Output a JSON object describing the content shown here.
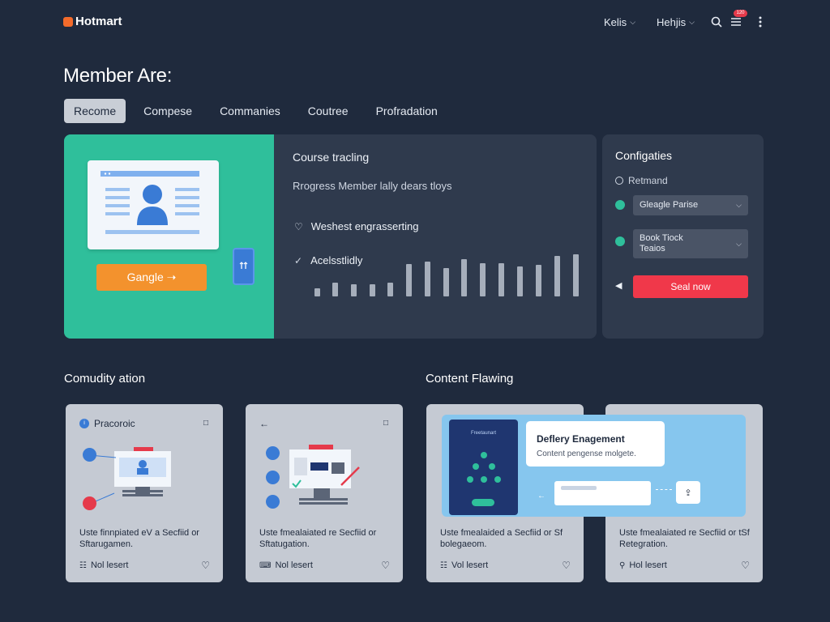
{
  "app": {
    "brand": "Hotmart"
  },
  "topbar": {
    "menu1": "Kelis",
    "menu2": "Hehjis",
    "notification_count": "120"
  },
  "page": {
    "title": "Member Are:"
  },
  "tabs": [
    {
      "label": "Recome",
      "active": true
    },
    {
      "label": "Compese"
    },
    {
      "label": "Commanies"
    },
    {
      "label": "Coutree"
    },
    {
      "label": "Profradation"
    }
  ],
  "hero": {
    "cta": "Gangle ➝",
    "heading": "Course tracling",
    "sub": "Rrogress Member lally dears tloys",
    "checks": [
      "Weshest engrasserting",
      "Acelsstlidly"
    ]
  },
  "config": {
    "title": "Configaties",
    "item1": "Retmand",
    "select1": "Gleagle Parise",
    "select2_line1": "Book Tiock",
    "select2_line2": "Teaios",
    "cta": "Seal now"
  },
  "sections": {
    "community": "Comudity ation",
    "content": "Content Flawing"
  },
  "cards": [
    {
      "head": "Pracoroic",
      "caption": "Uste finnpiated eV a Secfiid or Sftarugamen.",
      "footer": "Nol lesert"
    },
    {
      "head": "",
      "caption": "Uste fmealaiated re Secfiid or Sftatugation.",
      "footer": "Nol lesert"
    },
    {
      "head": "",
      "caption": "Uste fmealaided a Secfiid or Sf bolegaeom.",
      "footer": "Vol lesert"
    },
    {
      "head": "",
      "caption": "Uste fmealaiated re Secfiid or tSf Retegration.",
      "footer": "Hol lesert"
    }
  ],
  "banner": {
    "phone_title": "Freetaunart",
    "card_title": "Deflery Enagement",
    "card_sub": "Content pengense molgete."
  },
  "colors": {
    "bg": "#1f2a3d",
    "panel": "#2f3a4d",
    "accent_green": "#2fbf9b",
    "accent_orange": "#f3922d",
    "accent_red": "#f0384a",
    "accent_blue": "#3a7bd5"
  }
}
